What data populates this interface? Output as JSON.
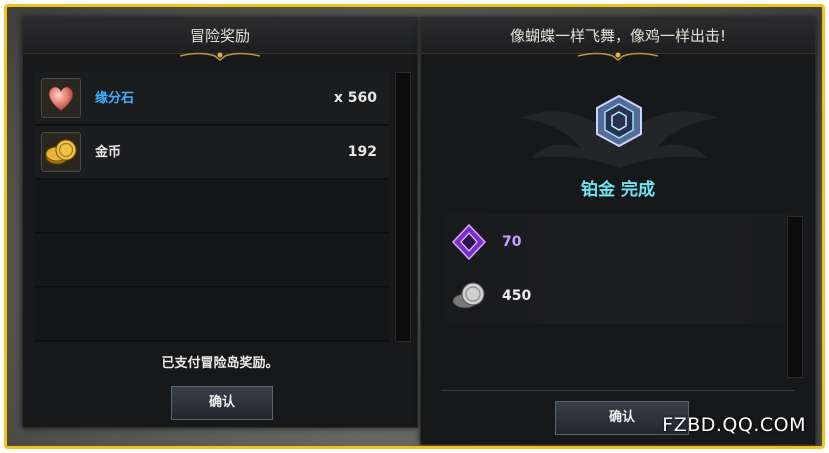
{
  "left_panel": {
    "title": "冒险奖励",
    "items": [
      {
        "name": "缘分石",
        "quantity": "x 560",
        "name_color": "#3eb0ff",
        "icon": "heart-stone-icon"
      },
      {
        "name": "金币",
        "quantity": "192",
        "name_color": "#e8e8e8",
        "icon": "gold-coins-icon"
      }
    ],
    "message": "已支付冒险岛奖励。",
    "confirm_label": "确认"
  },
  "right_panel": {
    "title": "像蝴蝶一样飞舞，像鸡一样出击!",
    "grade_text": "铂金 完成",
    "grade_icon": "platinum-emblem-icon",
    "rewards": [
      {
        "value": "70",
        "color": "#c9a0ff",
        "icon": "purple-crystal-icon"
      },
      {
        "value": "450",
        "color": "#eeeeee",
        "icon": "silver-coins-icon"
      }
    ],
    "confirm_label": "确认"
  },
  "watermark": "FZBD.QQ.COM",
  "colors": {
    "frame": "#f3c21b",
    "accent_cyan": "#6fe4f2",
    "link_blue": "#3eb0ff"
  }
}
